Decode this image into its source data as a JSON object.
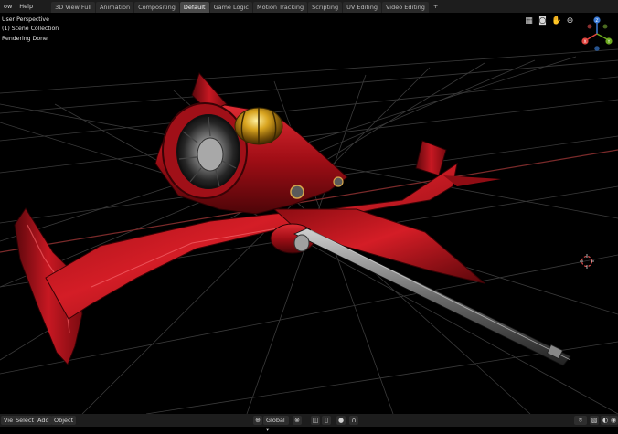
{
  "topbar": {
    "menus": [
      "ow",
      "Help"
    ],
    "tabs": [
      {
        "label": "3D View Full",
        "active": false
      },
      {
        "label": "Animation",
        "active": false
      },
      {
        "label": "Compositing",
        "active": false
      },
      {
        "label": "Default",
        "active": true
      },
      {
        "label": "Game Logic",
        "active": false
      },
      {
        "label": "Motion Tracking",
        "active": false
      },
      {
        "label": "Scripting",
        "active": false
      },
      {
        "label": "UV Editing",
        "active": false
      },
      {
        "label": "Video Editing",
        "active": false
      }
    ],
    "add_tab": "+"
  },
  "viewport": {
    "view_name": "User Perspective",
    "collection": "(1) Scene Collection",
    "status": "Rendering Done",
    "nav_icons": [
      "grid-icon",
      "camera-icon",
      "hand-icon",
      "zoom-icon"
    ],
    "gizmo": {
      "x": "X",
      "y": "Y",
      "z": "Z"
    }
  },
  "bottombar": {
    "view_label": "View",
    "select_label": "Select",
    "add_label": "Add",
    "object_label": "Object",
    "transform_orientation": "Global"
  },
  "colors": {
    "ship_red": "#b3121a",
    "gizmo_x": "#e0443e",
    "gizmo_y": "#6ba81c",
    "gizmo_z": "#3c7bd6"
  }
}
